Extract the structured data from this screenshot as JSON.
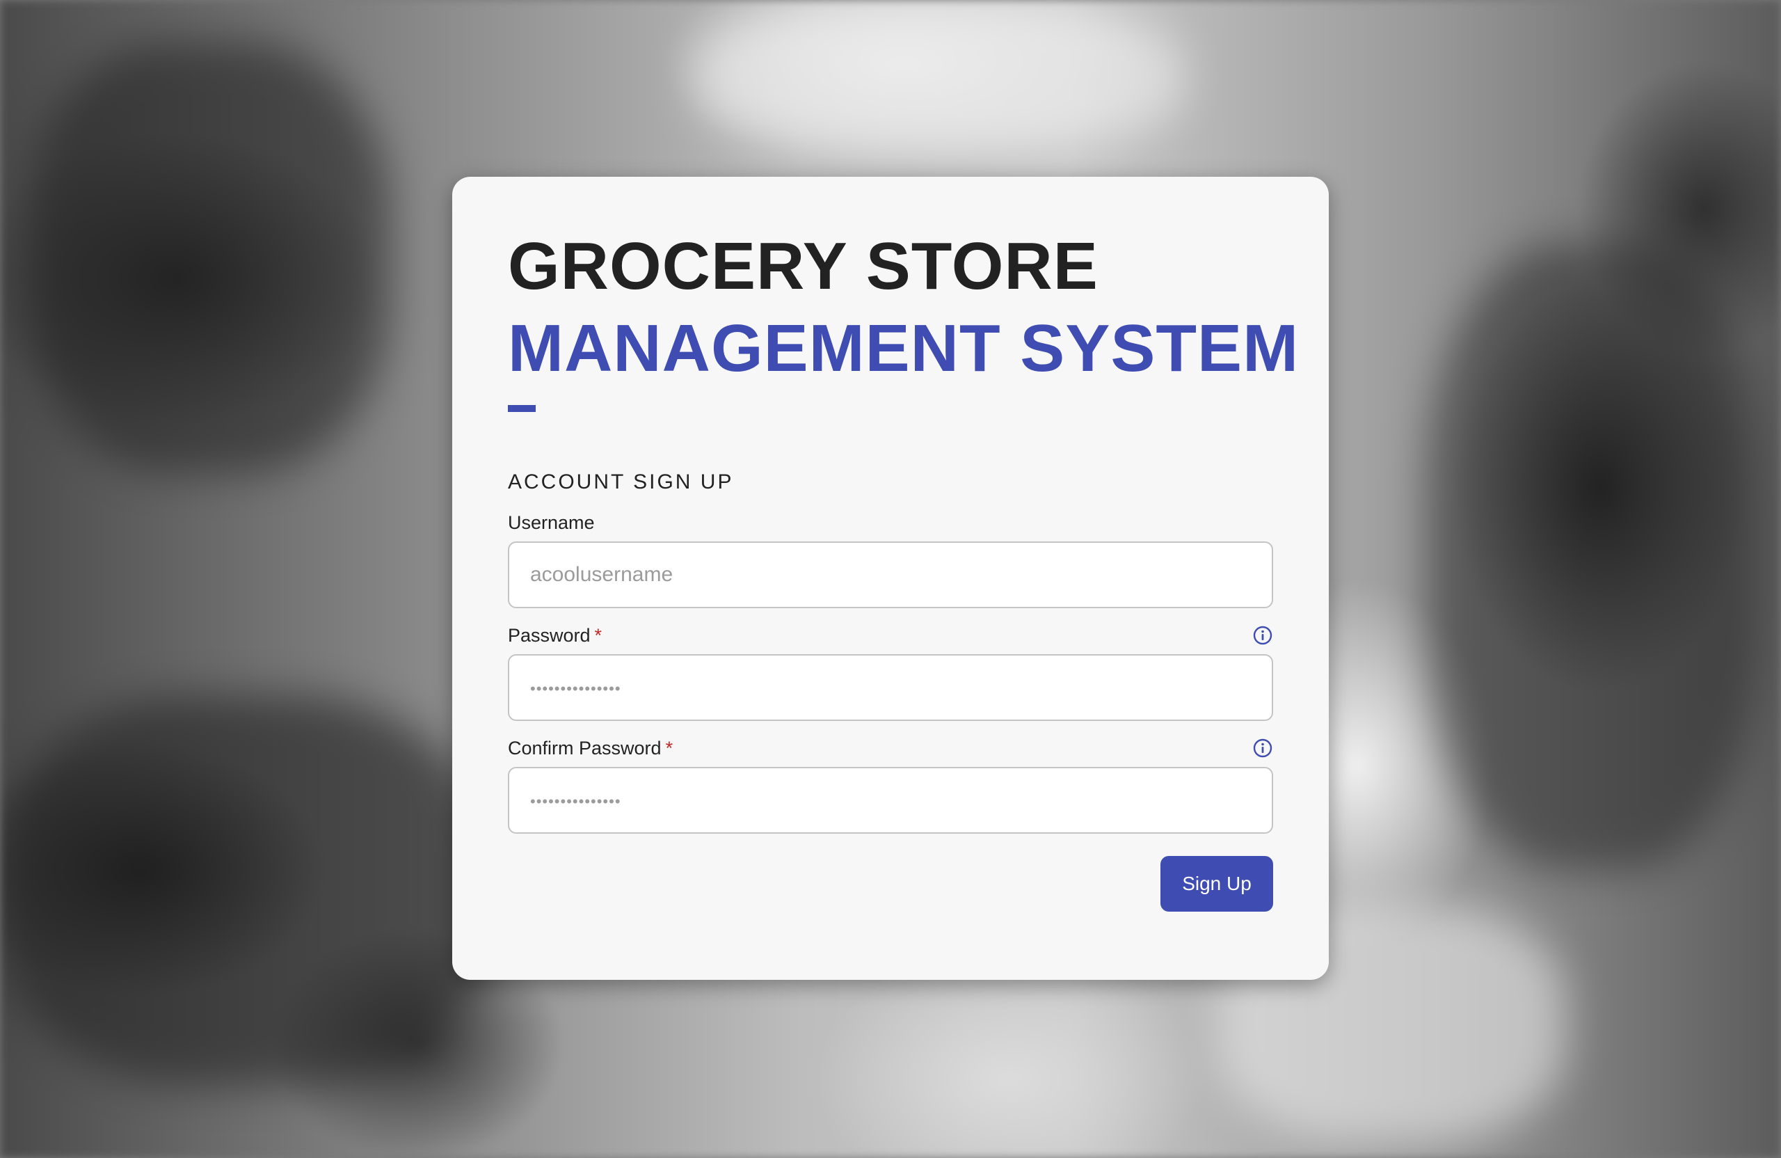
{
  "header": {
    "title_line1": "GROCERY STORE",
    "title_line2": "MANAGEMENT SYSTEM"
  },
  "form": {
    "heading": "ACCOUNT SIGN UP",
    "username": {
      "label": "Username",
      "placeholder": "acoolusername",
      "value": ""
    },
    "password": {
      "label": "Password",
      "required_marker": "*",
      "placeholder": "•••••••••••••••",
      "value": "",
      "icon": "info-icon"
    },
    "confirm_password": {
      "label": "Confirm Password",
      "required_marker": "*",
      "placeholder": "•••••••••••••••",
      "value": "",
      "icon": "info-icon"
    },
    "submit_label": "Sign Up"
  },
  "colors": {
    "accent": "#3f4db3",
    "required": "#c62828",
    "card_background": "#f7f7f7"
  }
}
